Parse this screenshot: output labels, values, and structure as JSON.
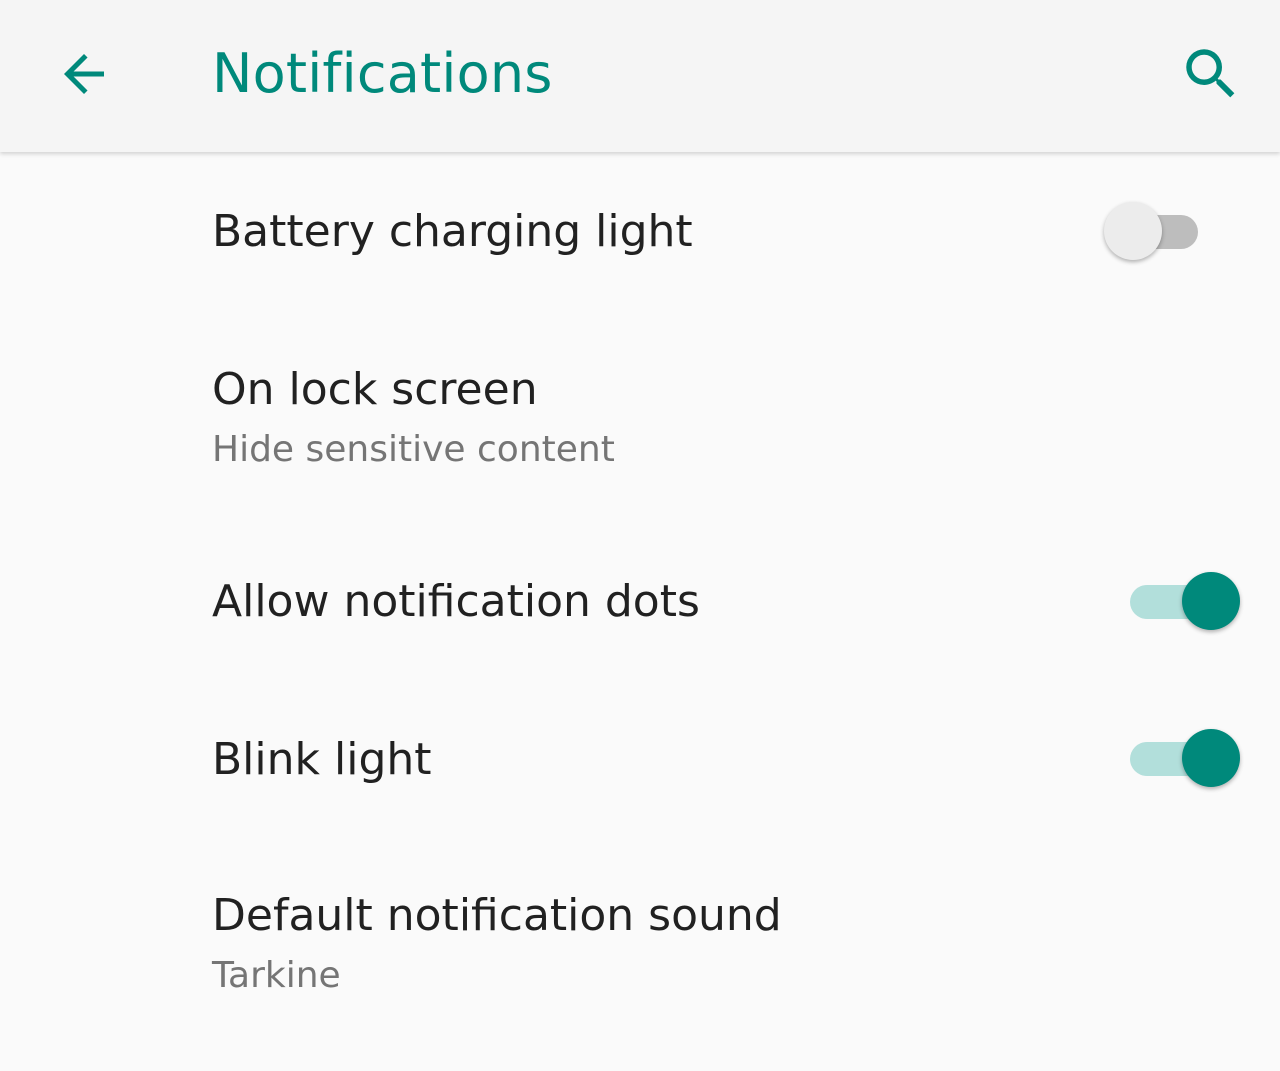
{
  "appbar": {
    "title": "Notifications",
    "back_icon": "arrow-left-icon",
    "search_icon": "search-icon",
    "accent_color": "#00897b"
  },
  "settings": {
    "battery_light": {
      "title": "Battery charging light",
      "enabled": false
    },
    "lock_screen": {
      "title": "On lock screen",
      "summary": "Hide sensitive content"
    },
    "notification_dots": {
      "title": "Allow notification dots",
      "enabled": true
    },
    "blink_light": {
      "title": "Blink light",
      "enabled": true
    },
    "notification_sound": {
      "title": "Default notification sound",
      "summary": "Tarkine"
    }
  }
}
